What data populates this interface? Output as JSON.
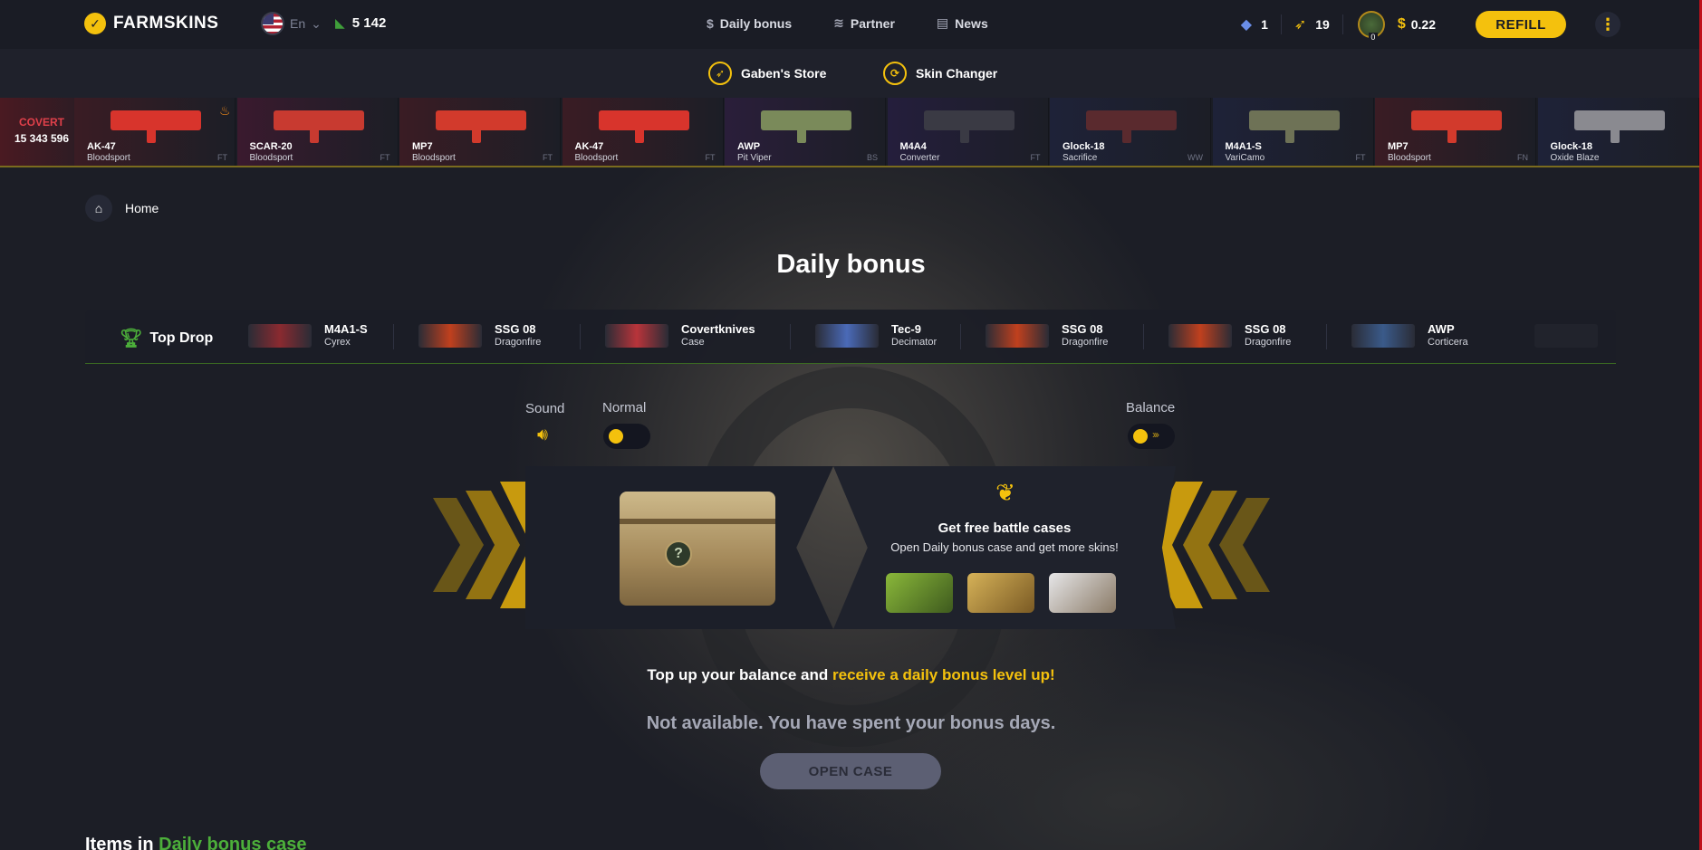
{
  "header": {
    "logo_text": "FARMSKINS",
    "language": "En",
    "online_count": "5 142",
    "nav": [
      {
        "label": "Daily bonus",
        "icon": "dollar-icon"
      },
      {
        "label": "Partner",
        "icon": "handshake-icon"
      },
      {
        "label": "News",
        "icon": "news-icon"
      }
    ],
    "gems": "1",
    "tokens": "19",
    "level": "0",
    "balance": "0.22",
    "refill_label": "REFILL"
  },
  "subnav": [
    {
      "label": "Gaben's Store",
      "icon": "rocket-icon"
    },
    {
      "label": "Skin Changer",
      "icon": "refresh-icon"
    }
  ],
  "live_drops": {
    "rarity": "COVERT",
    "total": "15 343 596",
    "items": [
      {
        "weapon": "AK-47",
        "skin": "Bloodsport",
        "exterior": "FT",
        "color": "#d8342c"
      },
      {
        "weapon": "SCAR-20",
        "skin": "Bloodsport",
        "exterior": "FT",
        "color": "#c83a30"
      },
      {
        "weapon": "MP7",
        "skin": "Bloodsport",
        "exterior": "FT",
        "color": "#d23a2c"
      },
      {
        "weapon": "AK-47",
        "skin": "Bloodsport",
        "exterior": "FT",
        "color": "#d8342c"
      },
      {
        "weapon": "AWP",
        "skin": "Pit Viper",
        "exterior": "BS",
        "color": "#7a8a5a"
      },
      {
        "weapon": "M4A4",
        "skin": "Converter",
        "exterior": "FT",
        "color": "#3a3a44"
      },
      {
        "weapon": "Glock-18",
        "skin": "Sacrifice",
        "exterior": "WW",
        "color": "#5a2a2e"
      },
      {
        "weapon": "M4A1-S",
        "skin": "VariCamo",
        "exterior": "FT",
        "color": "#6e7256"
      },
      {
        "weapon": "MP7",
        "skin": "Bloodsport",
        "exterior": "FN",
        "color": "#d23a2c"
      },
      {
        "weapon": "Glock-18",
        "skin": "Oxide Blaze",
        "exterior": "",
        "color": "#8a8a90"
      }
    ]
  },
  "breadcrumb": {
    "home": "Home"
  },
  "page_title": "Daily bonus",
  "top_drop": {
    "label": "Top Drop",
    "items": [
      {
        "name": "M4A1-S",
        "sub": "Cyrex",
        "color": "#8a2a30"
      },
      {
        "name": "SSG 08",
        "sub": "Dragonfire",
        "color": "#c0401e"
      },
      {
        "name": "Covertknives",
        "sub": "Case",
        "color": "#b8343a"
      },
      {
        "name": "Tec-9",
        "sub": "Decimator",
        "color": "#4a6ab8"
      },
      {
        "name": "SSG 08",
        "sub": "Dragonfire",
        "color": "#c0401e"
      },
      {
        "name": "SSG 08",
        "sub": "Dragonfire",
        "color": "#c0401e"
      },
      {
        "name": "AWP",
        "sub": "Corticera",
        "color": "#3a5a8a"
      }
    ]
  },
  "controls": {
    "sound_label": "Sound",
    "normal_label": "Normal",
    "balance_label": "Balance"
  },
  "battle": {
    "title": "Get free battle cases",
    "subtitle": "Open Daily bonus case and get more skins!"
  },
  "topup": {
    "text": "Top up your balance and",
    "highlight": "receive a daily bonus level up!"
  },
  "not_available": "Not available. You have spent your bonus days.",
  "open_case_label": "OPEN CASE",
  "items_in": {
    "prefix": "Items in",
    "case_name": "Daily bonus case"
  }
}
